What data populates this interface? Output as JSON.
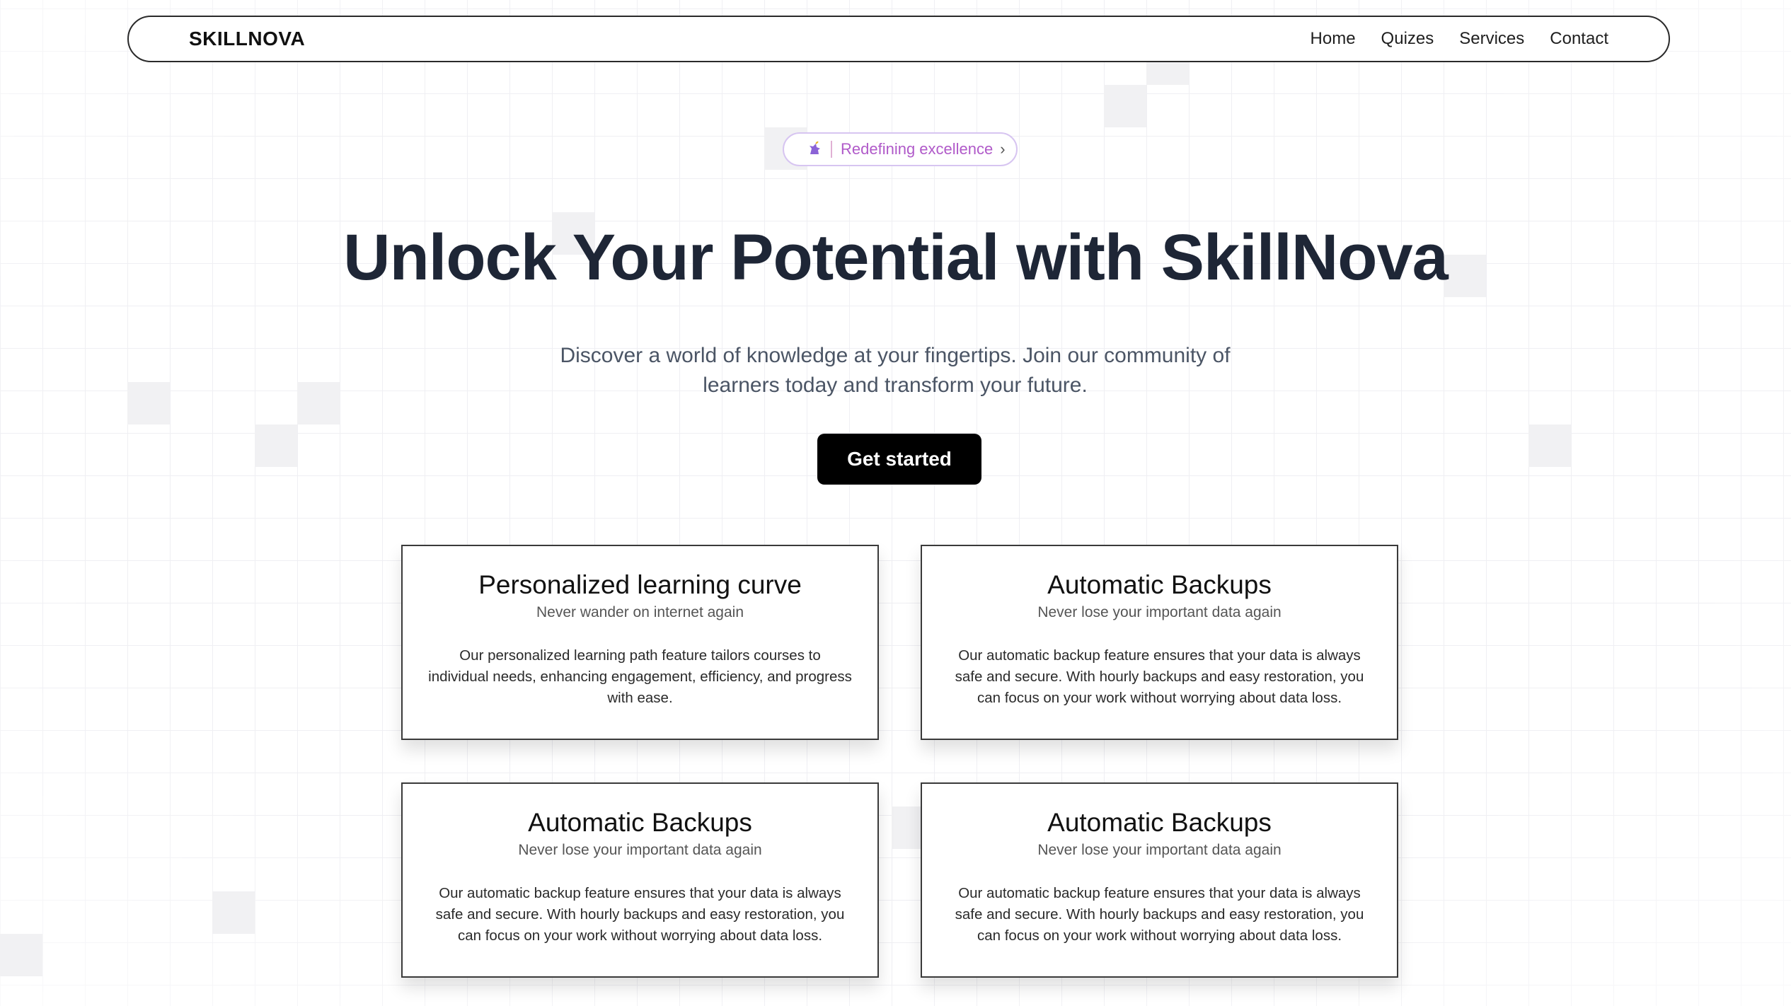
{
  "nav": {
    "brand": "SKILLNOVA",
    "links": [
      "Home",
      "Quizes",
      "Services",
      "Contact"
    ]
  },
  "badge": {
    "icon": "unicorn-icon",
    "text": "Redefining excellence",
    "chevron": "›"
  },
  "hero": {
    "title": "Unlock Your Potential with SkillNova",
    "subtitle": "Discover a world of knowledge at your fingertips. Join our community of learners today and transform your future.",
    "cta": "Get started"
  },
  "features": [
    {
      "title": "Personalized learning curve",
      "tagline": "Never wander on internet again",
      "description": "Our personalized learning path feature tailors courses to individual needs, enhancing engagement, efficiency, and progress with ease."
    },
    {
      "title": "Automatic Backups",
      "tagline": "Never lose your important data again",
      "description": "Our automatic backup feature ensures that your data is always safe and secure. With hourly backups and easy restoration, you can focus on your work without worrying about data loss."
    },
    {
      "title": "Automatic Backups",
      "tagline": "Never lose your important data again",
      "description": "Our automatic backup feature ensures that your data is always safe and secure. With hourly backups and easy restoration, you can focus on your work without worrying about data loss."
    },
    {
      "title": "Automatic Backups",
      "tagline": "Never lose your important data again",
      "description": "Our automatic backup feature ensures that your data is always safe and secure. With hourly backups and easy restoration, you can focus on your work without worrying about data loss."
    }
  ],
  "colors": {
    "brand_text": "#111111",
    "heading": "#1e2636",
    "badge_text": "#b05ac9",
    "badge_border": "#d7c5f1",
    "cta_bg": "#000000",
    "grid_line": "#efeff3"
  }
}
